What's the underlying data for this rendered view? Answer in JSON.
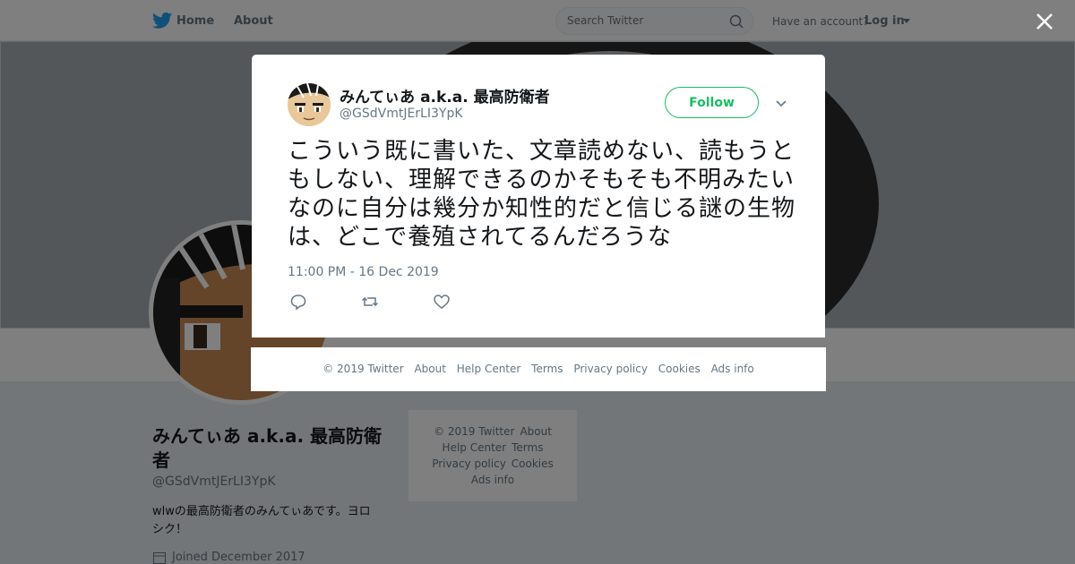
{
  "nav": {
    "home": "Home",
    "about": "About",
    "search_placeholder": "Search Twitter",
    "have_account": "Have an account?",
    "login": "Log in"
  },
  "profile": {
    "name": "みんてぃあ a.k.a. 最高防衛者",
    "handle": "@GSdVmtJErLI3YpK",
    "bio": "wlwの最高防衛者のみんてぃあです。ヨロシク！",
    "joined": "Joined December 2017"
  },
  "side_footer": {
    "copyright": "© 2019 Twitter",
    "about": "About",
    "help": "Help Center",
    "terms": "Terms",
    "privacy": "Privacy policy",
    "cookies": "Cookies",
    "ads": "Ads info"
  },
  "tweet": {
    "author_name": "みんてぃあ a.k.a. 最高防衛者",
    "author_handle": "@GSdVmtJErLI3YpK",
    "follow_label": "Follow",
    "text": "こういう既に書いた、文章読めない、読もうともしない、理解できるのかそもそも不明みたいなのに自分は幾分か知性的だと信じる謎の生物は、どこで養殖されてるんだろうな",
    "timestamp": "11:00 PM - 16 Dec 2019"
  },
  "modal_footer": {
    "copyright": "© 2019 Twitter",
    "about": "About",
    "help": "Help Center",
    "terms": "Terms",
    "privacy": "Privacy policy",
    "cookies": "Cookies",
    "ads": "Ads info"
  },
  "colors": {
    "accent": "#1da1f2",
    "follow_green": "#17bf63",
    "overlay": "rgba(0,0,0,0.5)"
  }
}
